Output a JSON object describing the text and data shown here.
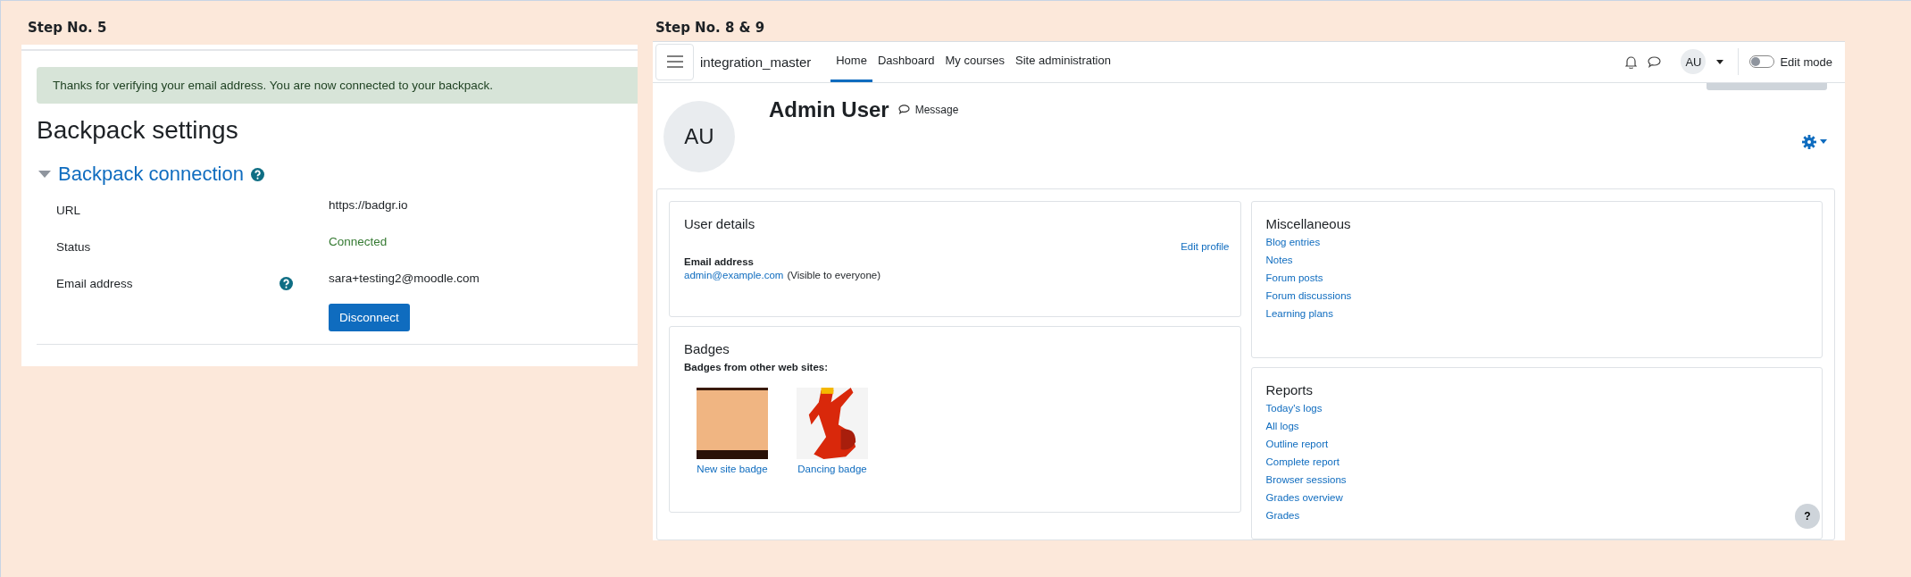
{
  "step5": {
    "caption": "Step No. 5",
    "alert": "Thanks for verifying your email address. You are now connected to your backpack.",
    "title": "Backpack settings",
    "section": {
      "title": "Backpack connection",
      "expanded": true
    },
    "fields": [
      {
        "label": "URL",
        "value": "https://badgr.io",
        "kind": "text",
        "help": false
      },
      {
        "label": "Status",
        "value": "Connected",
        "kind": "status",
        "help": false
      },
      {
        "label": "Email address",
        "value": "sara+testing2@moodle.com",
        "kind": "text",
        "help": true
      }
    ],
    "button": "Disconnect"
  },
  "step8_9": {
    "caption": "Step No. 8 & 9",
    "site_name": "integration_master",
    "nav": [
      {
        "label": "Home",
        "selected": true
      },
      {
        "label": "Dashboard",
        "selected": false
      },
      {
        "label": "My courses",
        "selected": false
      },
      {
        "label": "Site administration",
        "selected": false
      }
    ],
    "user_menu": {
      "initials": "AU"
    },
    "edit_mode": {
      "label": "Edit mode",
      "on": false
    },
    "profile": {
      "initials": "AU",
      "name": "Admin User",
      "message": "Message"
    },
    "user_details": {
      "title": "User details",
      "edit_link": "Edit profile",
      "email_label": "Email address",
      "email": "admin@example.com",
      "visibility": "(Visible to everyone)"
    },
    "badges": {
      "title": "Badges",
      "subtitle": "Badges from other web sites:",
      "items": [
        {
          "name": "New site badge",
          "kind": "photo"
        },
        {
          "name": "Dancing badge",
          "kind": "dancer"
        }
      ]
    },
    "miscellaneous": {
      "title": "Miscellaneous",
      "links": [
        "Blog entries",
        "Notes",
        "Forum posts",
        "Forum discussions",
        "Learning plans"
      ]
    },
    "reports": {
      "title": "Reports",
      "links": [
        "Today's logs",
        "All logs",
        "Outline report",
        "Complete report",
        "Browser sessions",
        "Grades overview",
        "Grades"
      ]
    },
    "help_button": "?"
  }
}
